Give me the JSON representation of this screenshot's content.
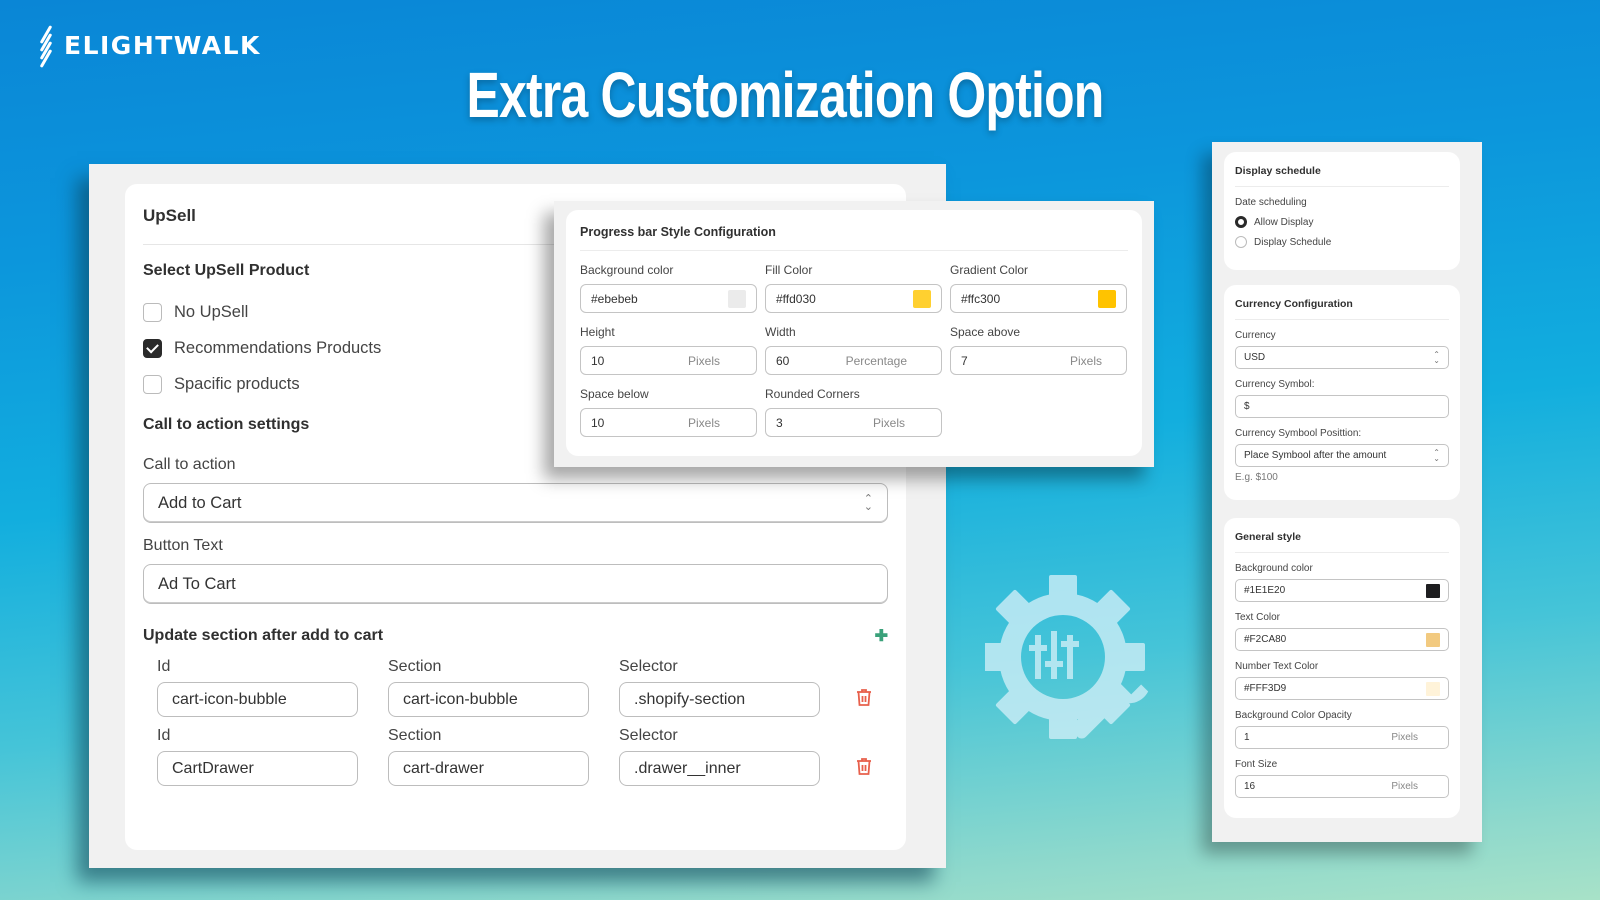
{
  "brand": {
    "name": "ELIGHTWALK",
    "logo_icon": "stripes-logo-icon"
  },
  "headline": "Extra Customization Option",
  "upsell": {
    "title": "UpSell",
    "select_heading": "Select UpSell Product",
    "options": [
      {
        "label": "No UpSell",
        "checked": false
      },
      {
        "label": "Recommendations Products",
        "checked": true
      },
      {
        "label": "Spacific products",
        "checked": false
      }
    ],
    "cta_heading": "Call to action settings",
    "cta_label": "Call to action",
    "cta_value": "Add to Cart",
    "button_text_label": "Button Text",
    "button_text_value": "Ad To Cart",
    "update_heading": "Update section after add to cart",
    "add_icon": "plus-icon",
    "columns": [
      "Id",
      "Section",
      "Selector"
    ],
    "rows": [
      {
        "id": "cart-icon-bubble",
        "section": "cart-icon-bubble",
        "selector": ".shopify-section"
      },
      {
        "id": "CartDrawer",
        "section": "cart-drawer",
        "selector": ".drawer__inner"
      }
    ],
    "delete_icon": "trash-icon",
    "delete_color": "#e8604c",
    "add_color": "#3aa17a"
  },
  "progress": {
    "title": "Progress bar Style Configuration",
    "fields": [
      {
        "label": "Background color",
        "value": "#ebebeb",
        "swatch": "#ebebeb"
      },
      {
        "label": "Fill Color",
        "value": "#ffd030",
        "swatch": "#ffd030"
      },
      {
        "label": "Gradient Color",
        "value": "#ffc300",
        "swatch": "#ffc300"
      },
      {
        "label": "Height",
        "value": "10",
        "unit": "Pixels"
      },
      {
        "label": "Width",
        "value": "60",
        "unit": "Percentage"
      },
      {
        "label": "Space above",
        "value": "7",
        "unit": "Pixels"
      },
      {
        "label": "Space below",
        "value": "10",
        "unit": "Pixels"
      },
      {
        "label": "Rounded Corners",
        "value": "3",
        "unit": "Pixels"
      }
    ]
  },
  "schedule": {
    "title": "Display schedule",
    "label": "Date scheduling",
    "options": [
      {
        "label": "Allow Display",
        "selected": true
      },
      {
        "label": "Display Schedule",
        "selected": false
      }
    ]
  },
  "currency": {
    "title": "Currency Configuration",
    "currency_label": "Currency",
    "currency_value": "USD",
    "symbol_label": "Currency Symbol:",
    "symbol_value": "$",
    "position_label": "Currency Symbool Posittion:",
    "position_value": "Place Symbool after the amount",
    "hint": "E.g. $100"
  },
  "general": {
    "title": "General style",
    "fields": [
      {
        "label": "Background color",
        "value": "#1E1E20",
        "swatch": "#1E1E20"
      },
      {
        "label": "Text Color",
        "value": "#F2CA80",
        "swatch": "#F2CA80"
      },
      {
        "label": "Number Text Color",
        "value": "#FFF3D9",
        "swatch": "#FFF3D9"
      },
      {
        "label": "Background Color Opacity",
        "value": "1",
        "unit": "Pixels"
      },
      {
        "label": "Font Size",
        "value": "16",
        "unit": "Pixels"
      }
    ]
  },
  "decor_icon": "gear-settings-wrench-icon"
}
